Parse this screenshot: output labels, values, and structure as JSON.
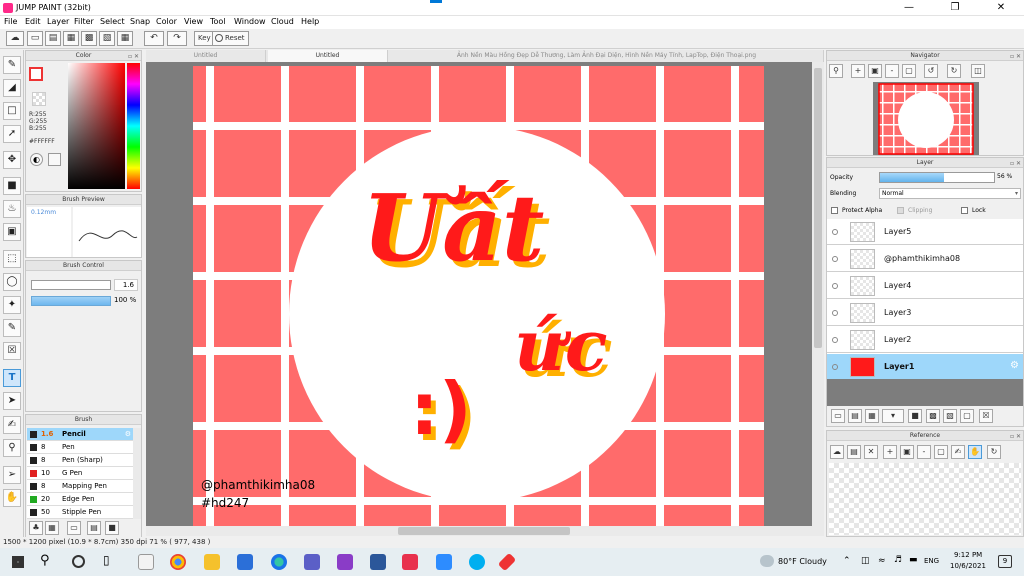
{
  "app": {
    "title": "JUMP PAINT (32bit)"
  },
  "menu": [
    "File",
    "Edit",
    "Layer",
    "Filter",
    "Select",
    "Snap",
    "Color",
    "View",
    "Tool",
    "Window",
    "Cloud",
    "Help"
  ],
  "toolbar": {
    "key_label": "Key",
    "reset_label": "Reset"
  },
  "tabs": [
    {
      "label": "Untitled",
      "active": false
    },
    {
      "label": "Untitled",
      "active": true
    },
    {
      "label": "Ảnh Nền Màu Hồng Đẹp Dễ Thương, Làm Ảnh Đại Diện, Hình Nền Máy Tính, LapTop, Điện Thoại.png",
      "active": false
    }
  ],
  "color_panel": {
    "title": "Color",
    "r": "R:255",
    "g": "G:255",
    "b": "B:255",
    "hex": "#FFFFFF"
  },
  "brush_preview": {
    "title": "Brush Preview",
    "size": "0.12mm"
  },
  "brush_control": {
    "title": "Brush Control",
    "size_value": "1.6",
    "opacity_value": "100 %"
  },
  "brush_panel": {
    "title": "Brush",
    "items": [
      {
        "size": "1.6",
        "name": "Pencil",
        "color": "#222222",
        "selected": true
      },
      {
        "size": "8",
        "name": "Pen",
        "color": "#222222",
        "selected": false
      },
      {
        "size": "8",
        "name": "Pen (Sharp)",
        "color": "#222222",
        "selected": false
      },
      {
        "size": "10",
        "name": "G Pen",
        "color": "#e02020",
        "selected": false
      },
      {
        "size": "8",
        "name": "Mapping Pen",
        "color": "#222222",
        "selected": false
      },
      {
        "size": "20",
        "name": "Edge Pen",
        "color": "#22aa22",
        "selected": false
      },
      {
        "size": "50",
        "name": "Stipple Pen",
        "color": "#222222",
        "selected": false
      }
    ]
  },
  "canvas": {
    "text_main": "Ưất",
    "text_sub": "ức",
    "text_smile": ":)",
    "watermark_user": "@phamthikimha08",
    "watermark_tag": "#hd247",
    "bg_color": "#ff6b6b",
    "lettering_color": "#ff1a1a",
    "shadow_color": "#ffb000"
  },
  "navigator": {
    "title": "Navigator"
  },
  "layer_panel": {
    "title": "Layer",
    "opacity_label": "Opacity",
    "opacity_value": "56 %",
    "opacity_fraction": 0.56,
    "blending_label": "Blending",
    "blending_value": "Normal",
    "protect_alpha_label": "Protect Alpha",
    "clipping_label": "Clipping",
    "lock_label": "Lock",
    "layers": [
      {
        "name": "Layer5",
        "selected": false
      },
      {
        "name": "@phamthikimha08",
        "selected": false
      },
      {
        "name": "Layer4",
        "selected": false
      },
      {
        "name": "Layer3",
        "selected": false
      },
      {
        "name": "Layer2",
        "selected": false
      },
      {
        "name": "Layer1",
        "selected": true
      }
    ]
  },
  "reference": {
    "title": "Reference"
  },
  "status": {
    "text": "1500 * 1200 pixel  (10.9 * 8.7cm)  350 dpi  71 %  ( 977, 438 )"
  },
  "taskbar": {
    "weather": "80°F  Cloudy",
    "lang": "ENG",
    "time": "9:12 PM",
    "date": "10/6/2021",
    "notif_count": "9"
  }
}
